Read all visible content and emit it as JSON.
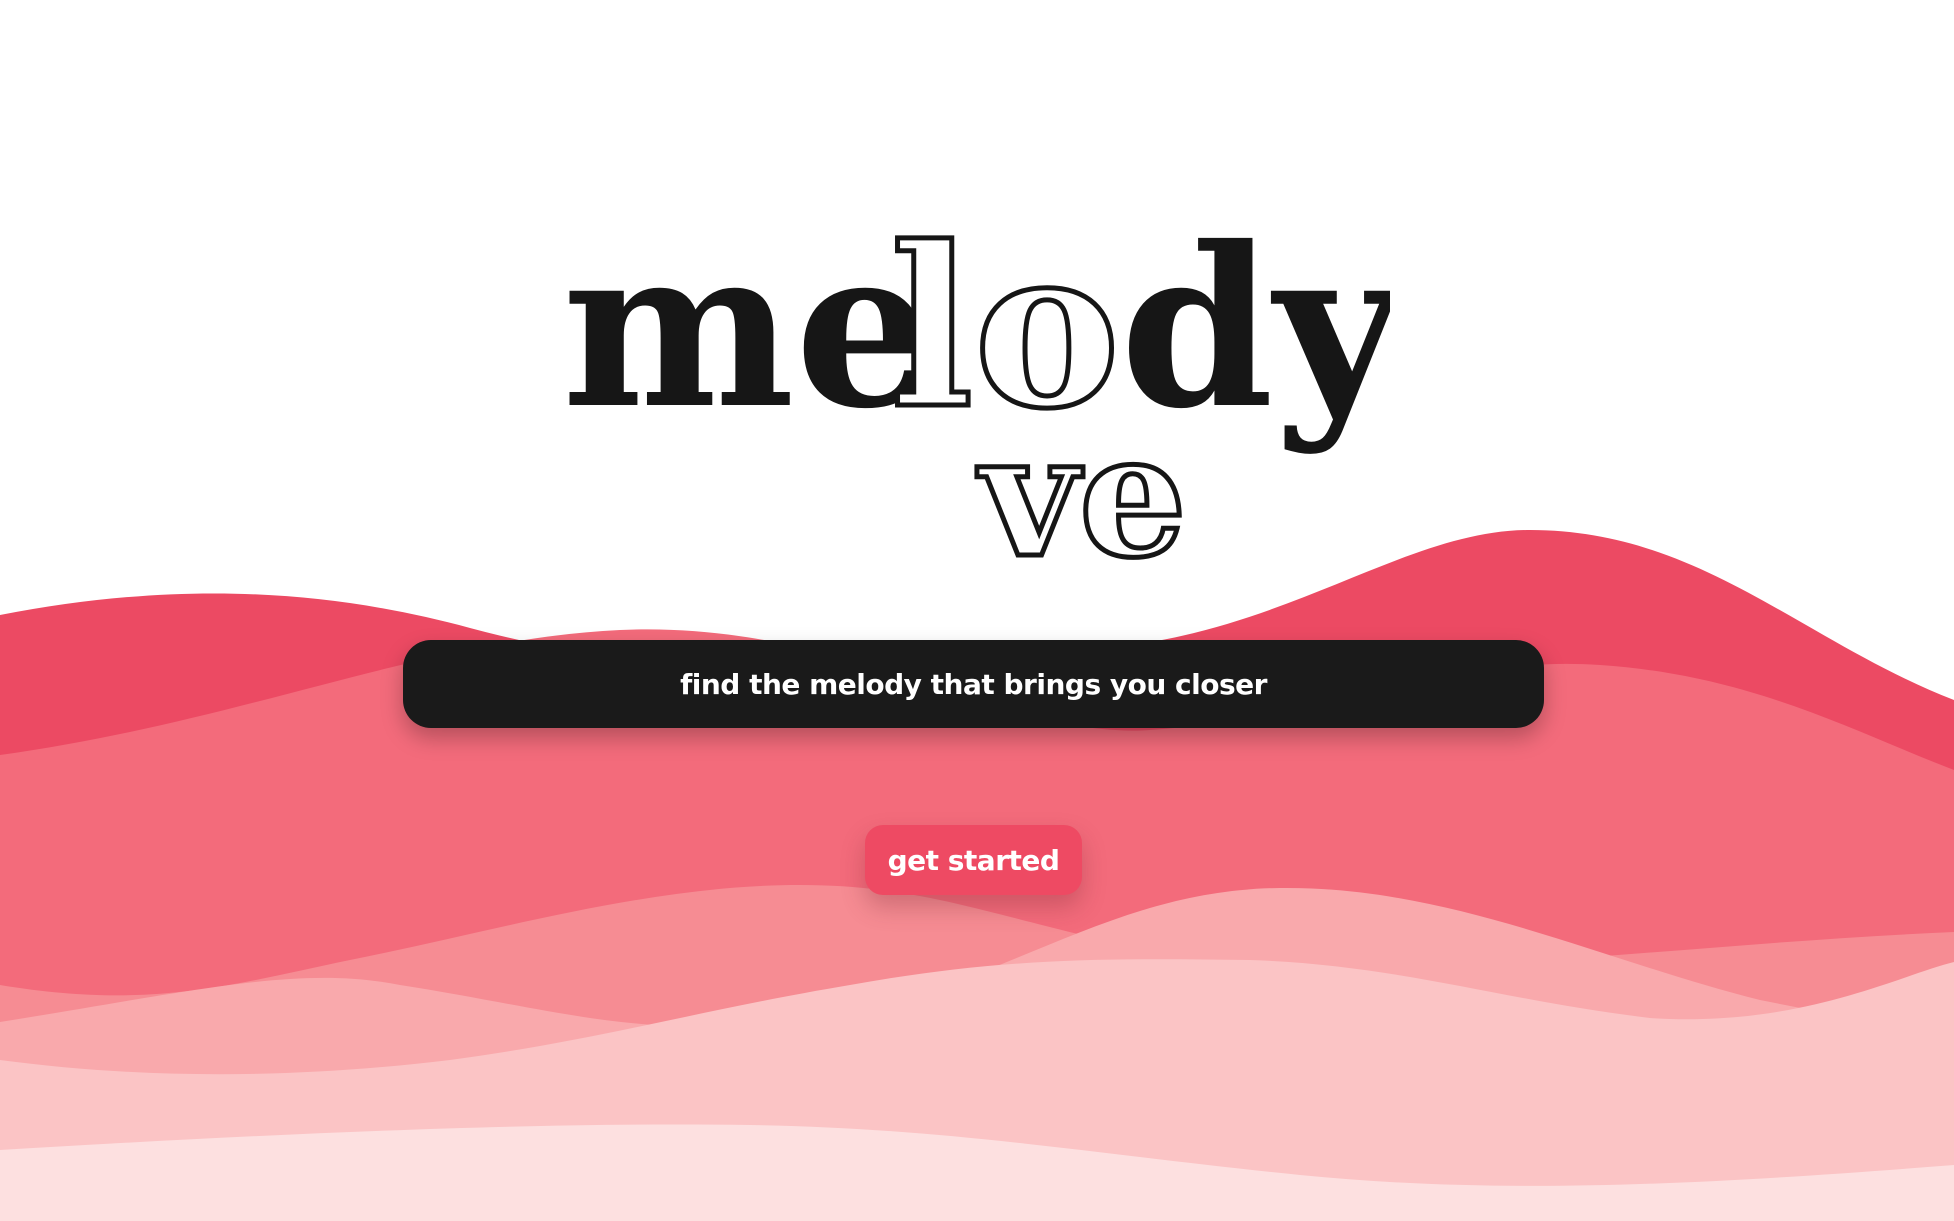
{
  "logo": {
    "word_top_solid_1": "me",
    "word_top_outline": "lo",
    "word_top_solid_2": "dy",
    "word_bottom_outline": "ve"
  },
  "tagline": {
    "text": "find the melody that brings you closer"
  },
  "cta": {
    "label": "get started"
  },
  "colors": {
    "wave_1": "#ec4a63",
    "wave_2": "#f36b7b",
    "wave_3": "#f68c93",
    "wave_4": "#f9a9ac",
    "wave_5": "#fbc4c5",
    "wave_6": "#fde0e0",
    "bar": "#1a1a1a",
    "button": "#ee4a63",
    "text_dark": "#161616"
  }
}
